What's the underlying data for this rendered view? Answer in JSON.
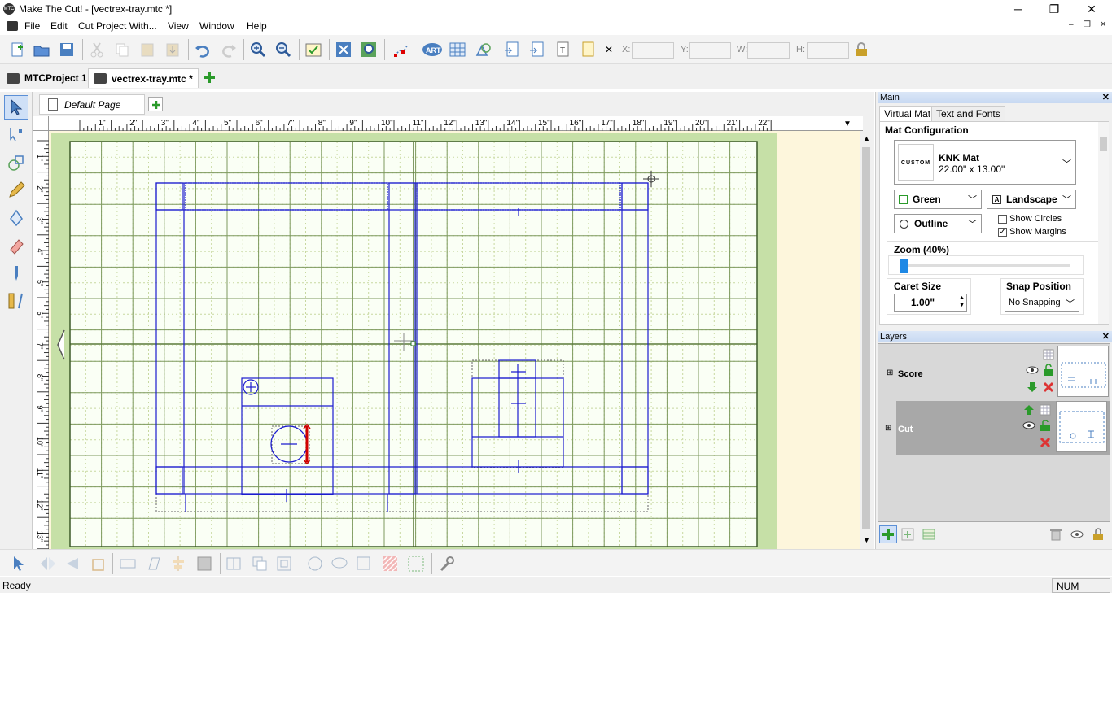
{
  "window": {
    "app_icon_text": "MTC",
    "title": "Make The Cut! - [vectrex-tray.mtc *]",
    "minimize": "─",
    "maximize": "❐",
    "close": "✕"
  },
  "menu": {
    "items": [
      "File",
      "Edit",
      "Cut Project With...",
      "View",
      "Window",
      "Help"
    ],
    "mdi_controls": [
      "–",
      "❐",
      "✕"
    ]
  },
  "toolbar": {
    "labels": {
      "x": "X:",
      "y": "Y:",
      "w": "W:",
      "h": "H:"
    },
    "close_small": "✕"
  },
  "project_tabs": [
    {
      "label": "MTCProject 1",
      "active": false
    },
    {
      "label": "vectrex-tray.mtc *",
      "active": true
    }
  ],
  "page_tab": {
    "label": "Default Page"
  },
  "ruler": {
    "h_labels": [
      "1\"",
      "2\"",
      "3\"",
      "4\"",
      "5\"",
      "6\"",
      "7\"",
      "8\"",
      "9\"",
      "10\"",
      "11\"",
      "12\"",
      "13\"",
      "14\"",
      "15\"",
      "16\"",
      "17\"",
      "18\"",
      "19\"",
      "20\"",
      "21\"",
      "22\""
    ],
    "v_labels": [
      "1\"",
      "2\"",
      "3\"",
      "4\"",
      "5\"",
      "6\"",
      "7\"",
      "8\"",
      "9\"",
      "10\"",
      "11\"",
      "12\"",
      "13\""
    ]
  },
  "status": {
    "text": "Ready",
    "num": "NUM"
  },
  "main_panel": {
    "title": "Main",
    "tabs": [
      "Virtual Mat",
      "Text and Fonts"
    ],
    "mat_configuration_label": "Mat Configuration",
    "mat_thumb_text": "CUSTOM",
    "mat_name": "KNK Mat",
    "mat_size": "22.00\" x 13.00\"",
    "mat_color": "Green",
    "orientation": "Landscape",
    "display_mode": "Outline",
    "show_circles_label": "Show Circles",
    "show_circles": false,
    "show_margins_label": "Show Margins",
    "show_margins": true,
    "zoom_label": "Zoom (40%)",
    "zoom_percent": 40,
    "caret_size_label": "Caret Size",
    "caret_size": "1.00\"",
    "snap_position_label": "Snap Position",
    "snap_value": "No Snapping"
  },
  "layers_panel": {
    "title": "Layers",
    "layers": [
      {
        "name": "Score",
        "selected": false
      },
      {
        "name": "Cut",
        "selected": true
      }
    ]
  },
  "colors": {
    "mat_green": "#c6e0a7",
    "mat_bg": "#fdf6dc",
    "grid_major": "#5a7a3a",
    "cut_blue": "#1c1ccf",
    "selection_red": "#d00000",
    "layer_selected": "#a8a8a8",
    "panel_header": "#c7d9f2"
  }
}
